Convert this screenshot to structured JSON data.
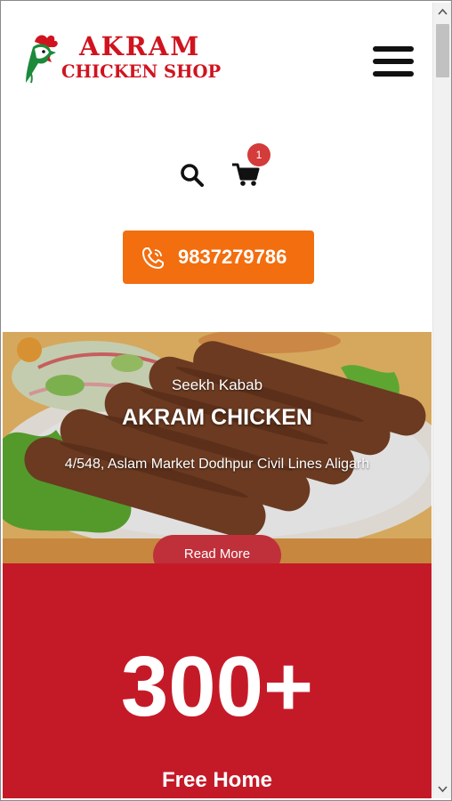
{
  "header": {
    "logo_line1": "AKRAM",
    "logo_line2": "CHICKEN SHOP",
    "brand_color": "#d0141f"
  },
  "actions": {
    "search_icon": "search-icon",
    "cart_icon": "cart-icon",
    "cart_count": "1",
    "phone_number": "9837279786",
    "phone_button_color": "#f26e0f"
  },
  "hero": {
    "subtitle": "Seekh Kabab",
    "title": "AKRAM CHICKEN",
    "address": "4/548, Aslam Market Dodhpur Civil Lines Aligarh",
    "button_label": "Read More"
  },
  "stats": {
    "number": "300+",
    "label": "Free Home",
    "background": "#c41a28"
  }
}
